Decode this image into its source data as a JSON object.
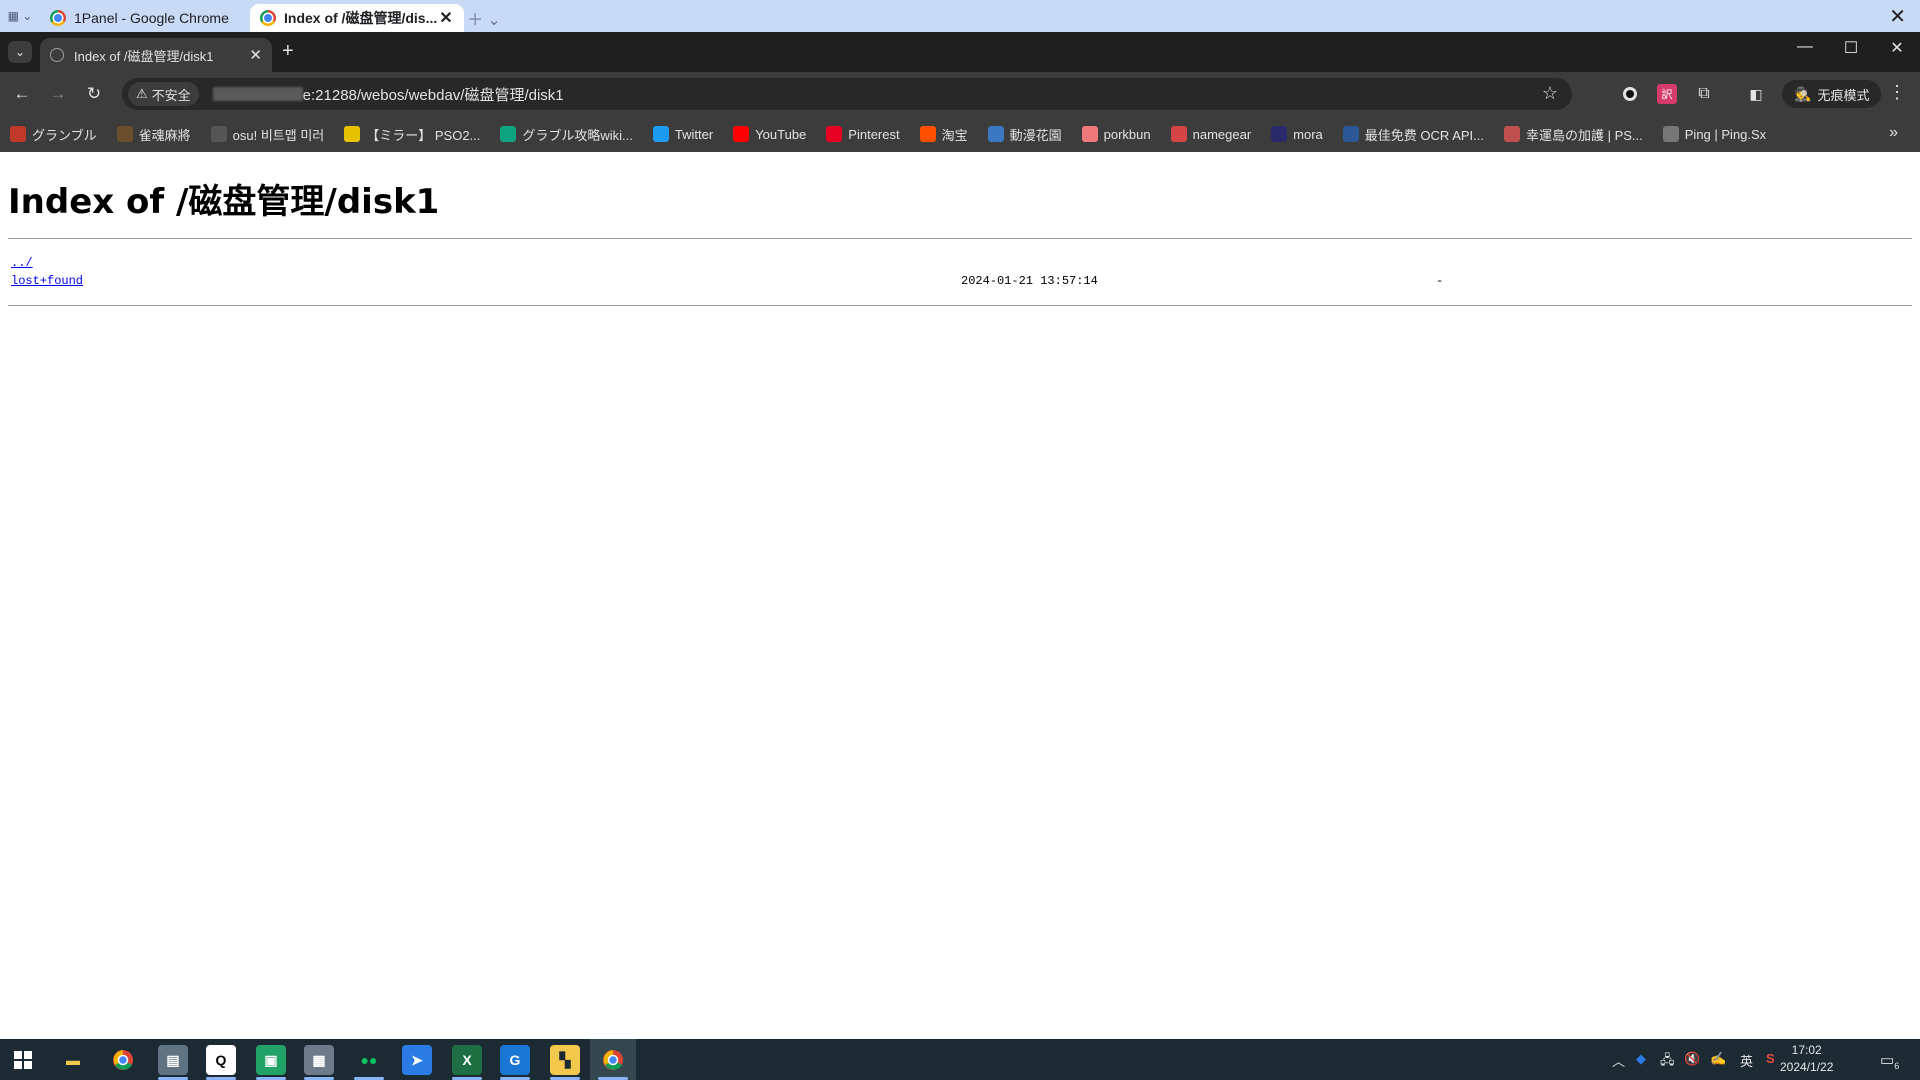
{
  "host_window": {
    "tabs": [
      {
        "title": "1Panel - Google Chrome",
        "active": false
      },
      {
        "title": "Index of /磁盘管理/dis...",
        "active": true
      }
    ]
  },
  "browser": {
    "tab_title": "Index of /磁盘管理/disk1",
    "security_label": "不安全",
    "url": "e:21288/webos/webdav/磁盘管理/disk1",
    "incognito_label": "无痕模式",
    "bookmarks": [
      {
        "label": "グランブル",
        "icon": "granblue-icon",
        "color": "#c0392b"
      },
      {
        "label": "雀魂麻將",
        "icon": "mahjong-icon",
        "color": "#6b4e2e"
      },
      {
        "label": "osu! 비트맵 미러",
        "icon": "github-icon",
        "color": "#555555"
      },
      {
        "label": "【ミラー】 PSO2...",
        "icon": "pso2-icon",
        "color": "#e6c200"
      },
      {
        "label": "グラブル攻略wiki...",
        "icon": "chatgpt-icon",
        "color": "#10a37f"
      },
      {
        "label": "Twitter",
        "icon": "twitter-icon",
        "color": "#1d9bf0"
      },
      {
        "label": "YouTube",
        "icon": "youtube-icon",
        "color": "#ff0000"
      },
      {
        "label": "Pinterest",
        "icon": "pinterest-icon",
        "color": "#e60023"
      },
      {
        "label": "淘宝",
        "icon": "taobao-icon",
        "color": "#ff5000"
      },
      {
        "label": "動漫花園",
        "icon": "dmhy-icon",
        "color": "#3a78c2"
      },
      {
        "label": "porkbun",
        "icon": "porkbun-icon",
        "color": "#ef7878"
      },
      {
        "label": "namegear",
        "icon": "namegear-icon",
        "color": "#d64545"
      },
      {
        "label": "mora",
        "icon": "mora-icon",
        "color": "#2a2a6a"
      },
      {
        "label": "最佳免费 OCR API...",
        "icon": "ocr-icon",
        "color": "#2b5797"
      },
      {
        "label": "幸運島の加護 | PS...",
        "icon": "pso2-blog-icon",
        "color": "#c0504d"
      },
      {
        "label": "Ping | Ping.Sx",
        "icon": "ping-icon",
        "color": "#777777"
      }
    ]
  },
  "page": {
    "heading": "Index of /磁盘管理/disk1",
    "entries": [
      {
        "name": "../",
        "date": "",
        "size": ""
      },
      {
        "name": "lost+found",
        "date": "2024-01-21 13:57:14",
        "size": "-"
      }
    ]
  },
  "taskbar": {
    "apps": [
      "start-icon",
      "file-explorer-icon",
      "chrome-icon",
      "remote-desktop-icon",
      "qq-icon",
      "terminal-icon",
      "calculator-icon",
      "wechat-icon",
      "feishu-icon",
      "excel-icon",
      "sync-icon",
      "sticky-notes-icon",
      "chrome-active-icon"
    ],
    "ime": "英",
    "time": "17:02",
    "date": "2024/1/22",
    "notification_count": "6"
  },
  "colors": {
    "chrome_dark": "#1f1f1f",
    "toolbar": "#3c3c3c",
    "host_strip": "#c9daf7",
    "link": "#0000ee",
    "taskbar": "#1c2a33"
  }
}
